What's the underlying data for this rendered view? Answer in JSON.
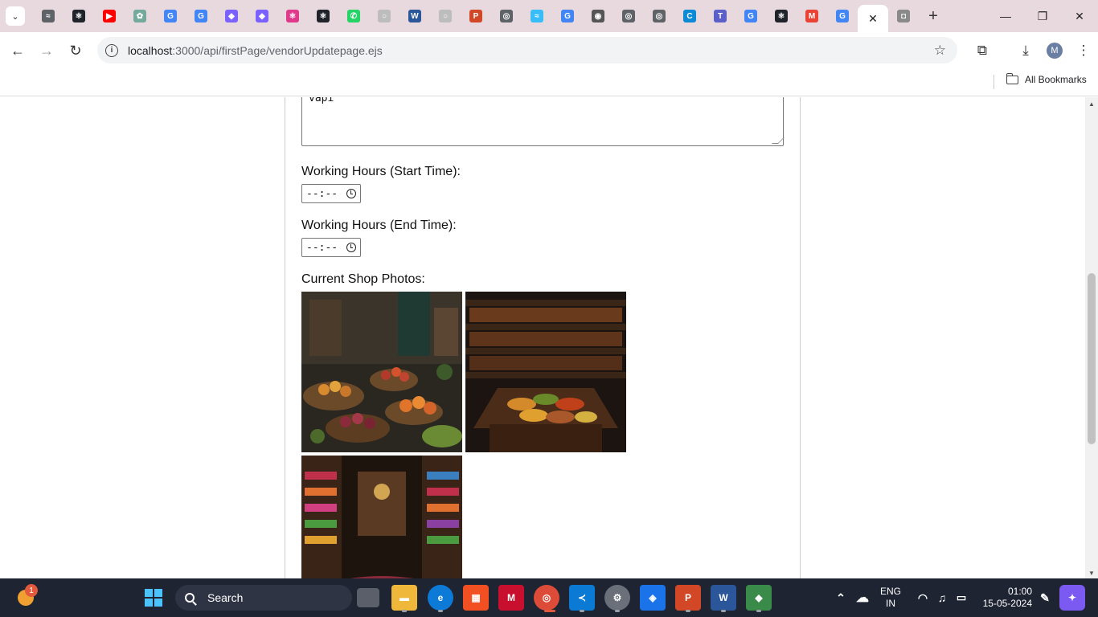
{
  "browser": {
    "url_host": "localhost",
    "url_rest": ":3000/api/firstPage/vendorUpdatepage.ejs",
    "bookmarks_label": "All Bookmarks",
    "profile_initial": "M",
    "tabs": [
      {
        "icon": "tab-icon-generic",
        "color": "#5f6368",
        "glyph": "≈"
      },
      {
        "icon": "tab-icon-react",
        "color": "#20232a",
        "glyph": "⚛"
      },
      {
        "icon": "tab-icon-youtube",
        "color": "#ff0000",
        "glyph": "▶"
      },
      {
        "icon": "tab-icon-chatgpt",
        "color": "#74aa9c",
        "glyph": "✿"
      },
      {
        "icon": "tab-icon-google",
        "color": "#4285f4",
        "glyph": "G"
      },
      {
        "icon": "tab-icon-google",
        "color": "#4285f4",
        "glyph": "G"
      },
      {
        "icon": "tab-icon-copilot",
        "color": "#7b61ff",
        "glyph": "◆"
      },
      {
        "icon": "tab-icon-copilot",
        "color": "#7b61ff",
        "glyph": "◆"
      },
      {
        "icon": "tab-icon-react",
        "color": "#e0388b",
        "glyph": "⚛"
      },
      {
        "icon": "tab-icon-react",
        "color": "#20232a",
        "glyph": "⚛"
      },
      {
        "icon": "tab-icon-whatsapp",
        "color": "#25d366",
        "glyph": "✆"
      },
      {
        "icon": "tab-icon-generic",
        "color": "#bdbdbd",
        "glyph": "○"
      },
      {
        "icon": "tab-icon-word",
        "color": "#2b579a",
        "glyph": "W"
      },
      {
        "icon": "tab-icon-generic",
        "color": "#bdbdbd",
        "glyph": "○"
      },
      {
        "icon": "tab-icon-powerpoint",
        "color": "#d24726",
        "glyph": "P"
      },
      {
        "icon": "tab-icon-chrome",
        "color": "#5f6368",
        "glyph": "◎"
      },
      {
        "icon": "tab-icon-tailwind",
        "color": "#38bdf8",
        "glyph": "≈"
      },
      {
        "icon": "tab-icon-google",
        "color": "#4285f4",
        "glyph": "G"
      },
      {
        "icon": "tab-icon-github",
        "color": "#555",
        "glyph": "◉"
      },
      {
        "icon": "tab-icon-chrome",
        "color": "#5f6368",
        "glyph": "◎"
      },
      {
        "icon": "tab-icon-chrome",
        "color": "#5f6368",
        "glyph": "◎"
      },
      {
        "icon": "tab-icon-edge",
        "color": "#0c8ad6",
        "glyph": "C"
      },
      {
        "icon": "tab-icon-teams",
        "color": "#5b5fc7",
        "glyph": "T"
      },
      {
        "icon": "tab-icon-google",
        "color": "#4285f4",
        "glyph": "G"
      },
      {
        "icon": "tab-icon-react",
        "color": "#20232a",
        "glyph": "⚛"
      },
      {
        "icon": "tab-icon-gmail",
        "color": "#ea4335",
        "glyph": "M"
      },
      {
        "icon": "tab-icon-google",
        "color": "#4285f4",
        "glyph": "G"
      }
    ]
  },
  "form": {
    "textarea_value": "vapi",
    "start_label": "Working Hours (Start Time):",
    "start_value": "--:--",
    "end_label": "Working Hours (End Time):",
    "end_value": "--:--",
    "photos_label": "Current Shop Photos:"
  },
  "taskbar": {
    "search_placeholder": "Search",
    "notification_count": "1",
    "lang_line1": "ENG",
    "lang_line2": "IN",
    "time": "01:00",
    "date": "15-05-2024"
  }
}
